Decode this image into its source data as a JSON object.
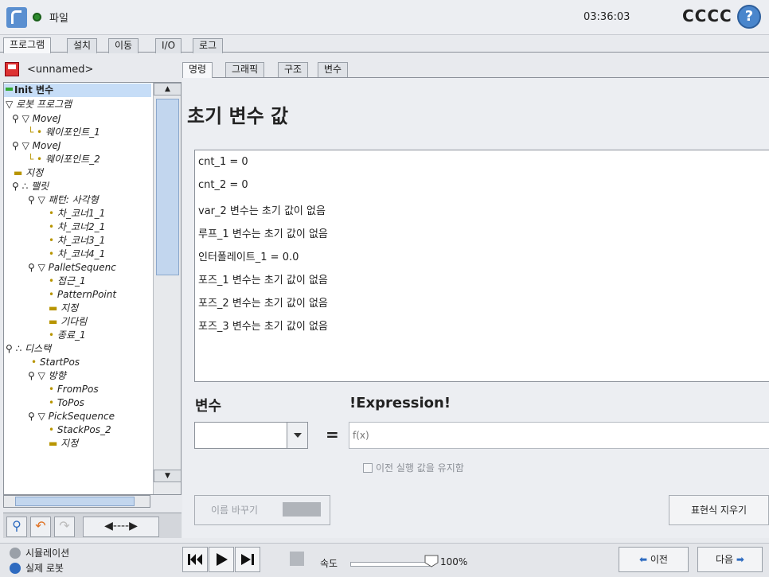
{
  "header": {
    "file_label": "파일",
    "clock": "03:36:03",
    "robot_name": "CCCC",
    "help_symbol": "?"
  },
  "main_tabs": [
    "프로그램",
    "설치",
    "이동",
    "I/O",
    "로그"
  ],
  "program": {
    "name": "<unnamed>"
  },
  "tree": [
    {
      "label": "Init 변수",
      "italic": false,
      "bold": true
    },
    {
      "label": "로봇 프로그램",
      "italic": true
    },
    {
      "label": "MoveJ",
      "italic": true
    },
    {
      "label": "웨이포인트_1",
      "italic": true
    },
    {
      "label": "MoveJ",
      "italic": true
    },
    {
      "label": "웨이포인트_2",
      "italic": true
    },
    {
      "label": "지정",
      "italic": true
    },
    {
      "label": "팰릿",
      "italic": true
    },
    {
      "label": "패턴: 사각형",
      "italic": true
    },
    {
      "label": "차_코너1_1",
      "italic": true
    },
    {
      "label": "차_코너2_1",
      "italic": true
    },
    {
      "label": "차_코너3_1",
      "italic": true
    },
    {
      "label": "차_코너4_1",
      "italic": true
    },
    {
      "label": "PalletSequenc",
      "italic": true
    },
    {
      "label": "접근_1",
      "italic": true
    },
    {
      "label": "PatternPoint",
      "italic": true
    },
    {
      "label": "지정",
      "italic": true
    },
    {
      "label": "기다림",
      "italic": true
    },
    {
      "label": "종료_1",
      "italic": true
    },
    {
      "label": "디스택",
      "italic": true
    },
    {
      "label": "StartPos",
      "italic": true
    },
    {
      "label": "방향",
      "italic": true
    },
    {
      "label": "FromPos",
      "italic": true
    },
    {
      "label": "ToPos",
      "italic": true
    },
    {
      "label": "PickSequence",
      "italic": true
    },
    {
      "label": "StackPos_2",
      "italic": true
    },
    {
      "label": "지정",
      "italic": true
    }
  ],
  "content_tabs": [
    "명령",
    "그래픽",
    "구조",
    "변수"
  ],
  "init_vars": {
    "title": "초기 변수 값",
    "lines": [
      "cnt_1 = 0",
      "cnt_2 = 0",
      "var_2 변수는 초기 값이 없음",
      "루프_1 변수는 초기 값이 없음",
      "인터폴레이트_1 = 0.0",
      "포즈_1 변수는 초기 값이 없음",
      "포즈_2 변수는 초기 값이 없음",
      "포즈_3 변수는 초기 값이 없음"
    ],
    "variable_label": "변수",
    "expression_label": "!Expression!",
    "equals": "=",
    "expression_placeholder": "f(x)",
    "keep_label": "이전 실행 값을 유지함",
    "rename_label": "이름 바꾸기",
    "clear_label": "표현식 지우기"
  },
  "footer": {
    "simulation": "시뮬레이션",
    "real_robot": "실제 로봇",
    "speed_label": "속도",
    "speed_value": "100%",
    "speed_fraction": 1.0,
    "prev_label": "이전",
    "next_label": "다음"
  }
}
